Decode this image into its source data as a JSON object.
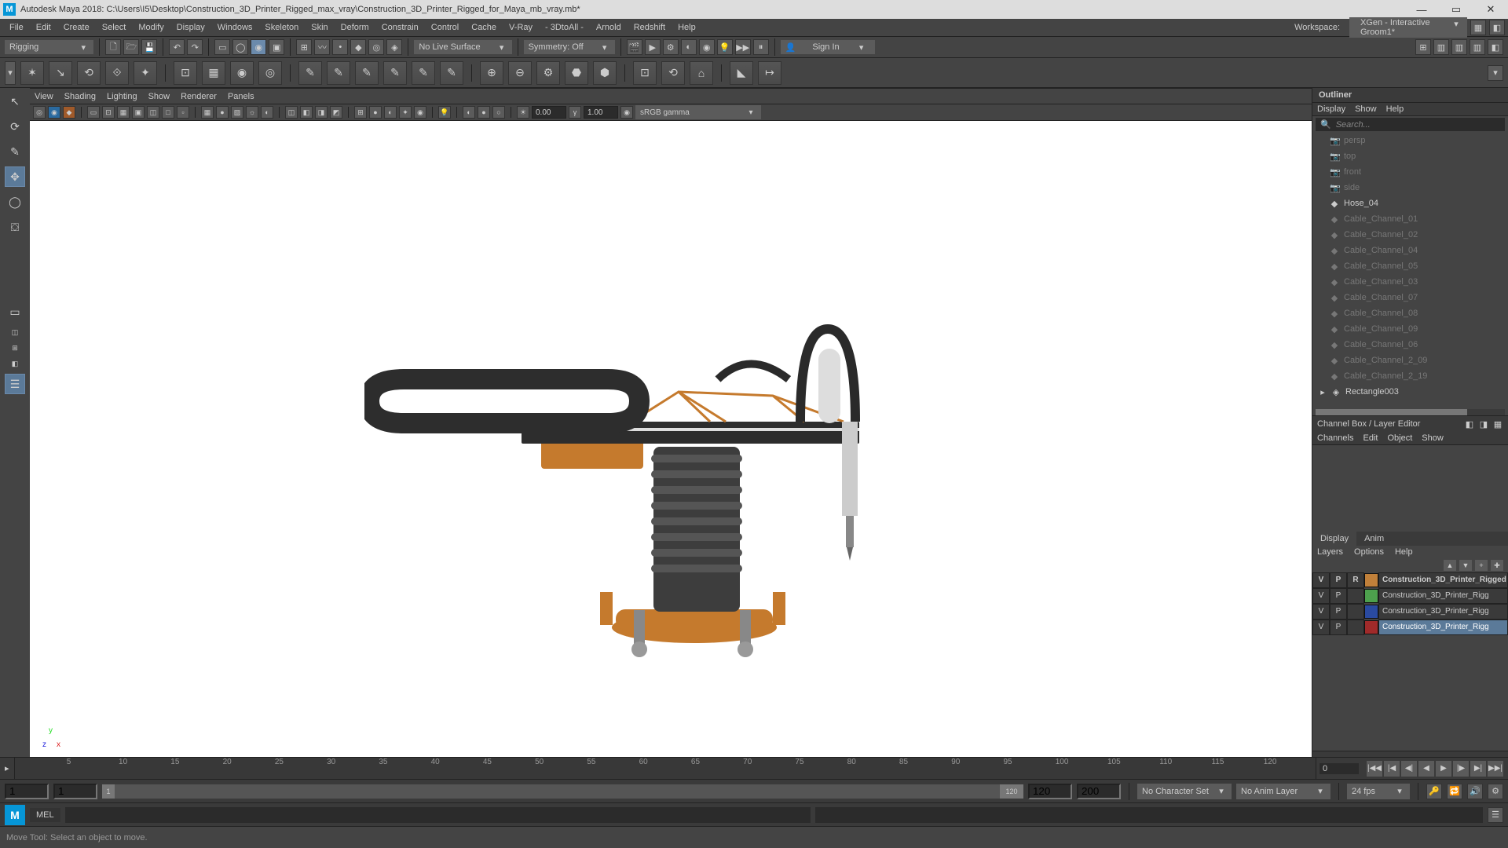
{
  "title": "Autodesk Maya 2018: C:\\Users\\I5\\Desktop\\Construction_3D_Printer_Rigged_max_vray\\Construction_3D_Printer_Rigged_for_Maya_mb_vray.mb*",
  "menus": [
    "File",
    "Edit",
    "Create",
    "Select",
    "Modify",
    "Display",
    "Windows",
    "Skeleton",
    "Skin",
    "Deform",
    "Constrain",
    "Control",
    "Cache",
    "V-Ray",
    "- 3DtoAll -",
    "Arnold",
    "Redshift",
    "Help"
  ],
  "workspace": {
    "label": "Workspace:",
    "value": "XGen - Interactive Groom1*"
  },
  "shelfCombo": "Rigging",
  "liveSurface": "No Live Surface",
  "symmetry": "Symmetry: Off",
  "signin": "Sign In",
  "panelMenus": [
    "View",
    "Shading",
    "Lighting",
    "Show",
    "Renderer",
    "Panels"
  ],
  "exposureVal": "0.00",
  "gammaVal": "1.00",
  "colorspace": "sRGB gamma",
  "outliner": {
    "title": "Outliner",
    "tabs": [
      "Display",
      "Show",
      "Help"
    ],
    "searchPh": "Search...",
    "items": [
      {
        "kind": "cam",
        "label": "persp",
        "dim": true
      },
      {
        "kind": "cam",
        "label": "top",
        "dim": true
      },
      {
        "kind": "cam",
        "label": "front",
        "dim": true
      },
      {
        "kind": "cam",
        "label": "side",
        "dim": true
      },
      {
        "kind": "obj",
        "label": "Hose_04",
        "dim": false
      },
      {
        "kind": "obj",
        "label": "Cable_Channel_01",
        "dim": true
      },
      {
        "kind": "obj",
        "label": "Cable_Channel_02",
        "dim": true
      },
      {
        "kind": "obj",
        "label": "Cable_Channel_04",
        "dim": true
      },
      {
        "kind": "obj",
        "label": "Cable_Channel_05",
        "dim": true
      },
      {
        "kind": "obj",
        "label": "Cable_Channel_03",
        "dim": true
      },
      {
        "kind": "obj",
        "label": "Cable_Channel_07",
        "dim": true
      },
      {
        "kind": "obj",
        "label": "Cable_Channel_08",
        "dim": true
      },
      {
        "kind": "obj",
        "label": "Cable_Channel_09",
        "dim": true
      },
      {
        "kind": "obj",
        "label": "Cable_Channel_06",
        "dim": true
      },
      {
        "kind": "obj",
        "label": "Cable_Channel_2_09",
        "dim": true
      },
      {
        "kind": "obj",
        "label": "Cable_Channel_2_19",
        "dim": true
      },
      {
        "kind": "grp",
        "label": "Rectangle003",
        "dim": false,
        "exp": true
      }
    ]
  },
  "channelBox": {
    "title": "Channel Box / Layer Editor",
    "tabs": [
      "Channels",
      "Edit",
      "Object",
      "Show"
    ]
  },
  "layerTabs": {
    "display": "Display",
    "anim": "Anim"
  },
  "layerMenus": [
    "Layers",
    "Options",
    "Help"
  ],
  "layerHdr": {
    "v": "V",
    "p": "P",
    "r": "R"
  },
  "layers": [
    {
      "v": "V",
      "p": "P",
      "r": "R",
      "color": "#c0803a",
      "name": "Construction_3D_Printer_Rigged"
    },
    {
      "v": "V",
      "p": "P",
      "r": "",
      "color": "#4da04d",
      "name": "Construction_3D_Printer_Rigg"
    },
    {
      "v": "V",
      "p": "P",
      "r": "",
      "color": "#2a4aa0",
      "name": "Construction_3D_Printer_Rigg"
    },
    {
      "v": "V",
      "p": "P",
      "r": "",
      "color": "#a02a2a",
      "name": "Construction_3D_Printer_Rigg",
      "sel": true
    }
  ],
  "timeline": {
    "ticks": [
      "5",
      "10",
      "15",
      "20",
      "25",
      "30",
      "35",
      "40",
      "45",
      "50",
      "55",
      "60",
      "65",
      "70",
      "75",
      "80",
      "85",
      "90",
      "95",
      "100",
      "105",
      "110",
      "115",
      "120"
    ],
    "current": "0"
  },
  "range": {
    "startA": "1",
    "startB": "1",
    "slideStart": "1",
    "slideEnd": "120",
    "endA": "120",
    "endB": "200",
    "charSet": "No Character Set",
    "animLayer": "No Anim Layer",
    "fps": "24 fps"
  },
  "cmd": {
    "lang": "MEL"
  },
  "status": "Move Tool: Select an object to move."
}
